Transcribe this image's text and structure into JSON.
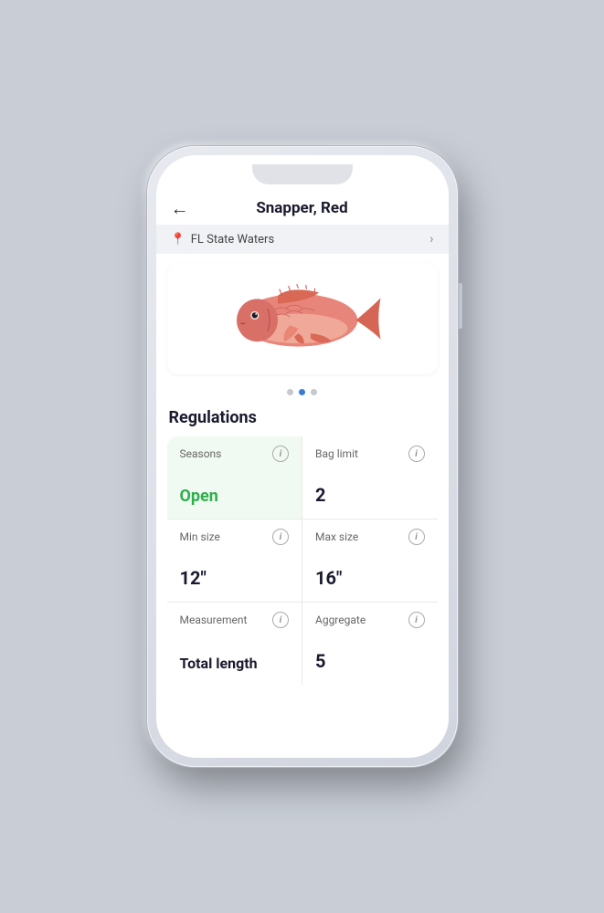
{
  "phone": {
    "header": {
      "back_label": "←",
      "title": "Snapper, Red"
    },
    "location": {
      "label": "FL State Waters",
      "chevron": "›"
    },
    "dots": [
      {
        "id": 1,
        "active": false
      },
      {
        "id": 2,
        "active": true
      },
      {
        "id": 3,
        "active": false
      }
    ],
    "regulations": {
      "section_title": "Regulations",
      "cards": [
        {
          "id": "seasons",
          "label": "Seasons",
          "value": "Open",
          "value_style": "green",
          "green_bg": true
        },
        {
          "id": "bag_limit",
          "label": "Bag limit",
          "value": "2",
          "value_style": "normal",
          "green_bg": false
        },
        {
          "id": "min_size",
          "label": "Min size",
          "value": "12\"",
          "value_style": "normal",
          "green_bg": false
        },
        {
          "id": "max_size",
          "label": "Max size",
          "value": "16\"",
          "value_style": "normal",
          "green_bg": false
        },
        {
          "id": "measurement",
          "label": "Measurement",
          "value": "Total length",
          "value_style": "bold-text",
          "green_bg": false
        },
        {
          "id": "aggregate",
          "label": "Aggregate",
          "value": "5",
          "value_style": "normal",
          "green_bg": false
        }
      ]
    },
    "info_icon_label": "i",
    "colors": {
      "accent_green": "#2db04b",
      "accent_blue": "#3a7bd5"
    }
  }
}
